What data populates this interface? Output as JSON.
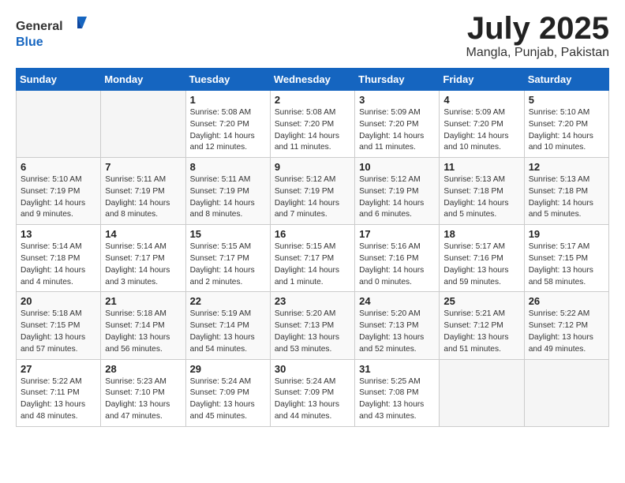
{
  "logo": {
    "general": "General",
    "blue": "Blue"
  },
  "title": {
    "month_year": "July 2025",
    "location": "Mangla, Punjab, Pakistan"
  },
  "headers": [
    "Sunday",
    "Monday",
    "Tuesday",
    "Wednesday",
    "Thursday",
    "Friday",
    "Saturday"
  ],
  "weeks": [
    [
      {
        "day": "",
        "sunrise": "",
        "sunset": "",
        "daylight": "",
        "empty": true
      },
      {
        "day": "",
        "sunrise": "",
        "sunset": "",
        "daylight": "",
        "empty": true
      },
      {
        "day": "1",
        "sunrise": "Sunrise: 5:08 AM",
        "sunset": "Sunset: 7:20 PM",
        "daylight": "Daylight: 14 hours and 12 minutes.",
        "empty": false
      },
      {
        "day": "2",
        "sunrise": "Sunrise: 5:08 AM",
        "sunset": "Sunset: 7:20 PM",
        "daylight": "Daylight: 14 hours and 11 minutes.",
        "empty": false
      },
      {
        "day": "3",
        "sunrise": "Sunrise: 5:09 AM",
        "sunset": "Sunset: 7:20 PM",
        "daylight": "Daylight: 14 hours and 11 minutes.",
        "empty": false
      },
      {
        "day": "4",
        "sunrise": "Sunrise: 5:09 AM",
        "sunset": "Sunset: 7:20 PM",
        "daylight": "Daylight: 14 hours and 10 minutes.",
        "empty": false
      },
      {
        "day": "5",
        "sunrise": "Sunrise: 5:10 AM",
        "sunset": "Sunset: 7:20 PM",
        "daylight": "Daylight: 14 hours and 10 minutes.",
        "empty": false
      }
    ],
    [
      {
        "day": "6",
        "sunrise": "Sunrise: 5:10 AM",
        "sunset": "Sunset: 7:19 PM",
        "daylight": "Daylight: 14 hours and 9 minutes.",
        "empty": false
      },
      {
        "day": "7",
        "sunrise": "Sunrise: 5:11 AM",
        "sunset": "Sunset: 7:19 PM",
        "daylight": "Daylight: 14 hours and 8 minutes.",
        "empty": false
      },
      {
        "day": "8",
        "sunrise": "Sunrise: 5:11 AM",
        "sunset": "Sunset: 7:19 PM",
        "daylight": "Daylight: 14 hours and 8 minutes.",
        "empty": false
      },
      {
        "day": "9",
        "sunrise": "Sunrise: 5:12 AM",
        "sunset": "Sunset: 7:19 PM",
        "daylight": "Daylight: 14 hours and 7 minutes.",
        "empty": false
      },
      {
        "day": "10",
        "sunrise": "Sunrise: 5:12 AM",
        "sunset": "Sunset: 7:19 PM",
        "daylight": "Daylight: 14 hours and 6 minutes.",
        "empty": false
      },
      {
        "day": "11",
        "sunrise": "Sunrise: 5:13 AM",
        "sunset": "Sunset: 7:18 PM",
        "daylight": "Daylight: 14 hours and 5 minutes.",
        "empty": false
      },
      {
        "day": "12",
        "sunrise": "Sunrise: 5:13 AM",
        "sunset": "Sunset: 7:18 PM",
        "daylight": "Daylight: 14 hours and 5 minutes.",
        "empty": false
      }
    ],
    [
      {
        "day": "13",
        "sunrise": "Sunrise: 5:14 AM",
        "sunset": "Sunset: 7:18 PM",
        "daylight": "Daylight: 14 hours and 4 minutes.",
        "empty": false
      },
      {
        "day": "14",
        "sunrise": "Sunrise: 5:14 AM",
        "sunset": "Sunset: 7:17 PM",
        "daylight": "Daylight: 14 hours and 3 minutes.",
        "empty": false
      },
      {
        "day": "15",
        "sunrise": "Sunrise: 5:15 AM",
        "sunset": "Sunset: 7:17 PM",
        "daylight": "Daylight: 14 hours and 2 minutes.",
        "empty": false
      },
      {
        "day": "16",
        "sunrise": "Sunrise: 5:15 AM",
        "sunset": "Sunset: 7:17 PM",
        "daylight": "Daylight: 14 hours and 1 minute.",
        "empty": false
      },
      {
        "day": "17",
        "sunrise": "Sunrise: 5:16 AM",
        "sunset": "Sunset: 7:16 PM",
        "daylight": "Daylight: 14 hours and 0 minutes.",
        "empty": false
      },
      {
        "day": "18",
        "sunrise": "Sunrise: 5:17 AM",
        "sunset": "Sunset: 7:16 PM",
        "daylight": "Daylight: 13 hours and 59 minutes.",
        "empty": false
      },
      {
        "day": "19",
        "sunrise": "Sunrise: 5:17 AM",
        "sunset": "Sunset: 7:15 PM",
        "daylight": "Daylight: 13 hours and 58 minutes.",
        "empty": false
      }
    ],
    [
      {
        "day": "20",
        "sunrise": "Sunrise: 5:18 AM",
        "sunset": "Sunset: 7:15 PM",
        "daylight": "Daylight: 13 hours and 57 minutes.",
        "empty": false
      },
      {
        "day": "21",
        "sunrise": "Sunrise: 5:18 AM",
        "sunset": "Sunset: 7:14 PM",
        "daylight": "Daylight: 13 hours and 56 minutes.",
        "empty": false
      },
      {
        "day": "22",
        "sunrise": "Sunrise: 5:19 AM",
        "sunset": "Sunset: 7:14 PM",
        "daylight": "Daylight: 13 hours and 54 minutes.",
        "empty": false
      },
      {
        "day": "23",
        "sunrise": "Sunrise: 5:20 AM",
        "sunset": "Sunset: 7:13 PM",
        "daylight": "Daylight: 13 hours and 53 minutes.",
        "empty": false
      },
      {
        "day": "24",
        "sunrise": "Sunrise: 5:20 AM",
        "sunset": "Sunset: 7:13 PM",
        "daylight": "Daylight: 13 hours and 52 minutes.",
        "empty": false
      },
      {
        "day": "25",
        "sunrise": "Sunrise: 5:21 AM",
        "sunset": "Sunset: 7:12 PM",
        "daylight": "Daylight: 13 hours and 51 minutes.",
        "empty": false
      },
      {
        "day": "26",
        "sunrise": "Sunrise: 5:22 AM",
        "sunset": "Sunset: 7:12 PM",
        "daylight": "Daylight: 13 hours and 49 minutes.",
        "empty": false
      }
    ],
    [
      {
        "day": "27",
        "sunrise": "Sunrise: 5:22 AM",
        "sunset": "Sunset: 7:11 PM",
        "daylight": "Daylight: 13 hours and 48 minutes.",
        "empty": false
      },
      {
        "day": "28",
        "sunrise": "Sunrise: 5:23 AM",
        "sunset": "Sunset: 7:10 PM",
        "daylight": "Daylight: 13 hours and 47 minutes.",
        "empty": false
      },
      {
        "day": "29",
        "sunrise": "Sunrise: 5:24 AM",
        "sunset": "Sunset: 7:09 PM",
        "daylight": "Daylight: 13 hours and 45 minutes.",
        "empty": false
      },
      {
        "day": "30",
        "sunrise": "Sunrise: 5:24 AM",
        "sunset": "Sunset: 7:09 PM",
        "daylight": "Daylight: 13 hours and 44 minutes.",
        "empty": false
      },
      {
        "day": "31",
        "sunrise": "Sunrise: 5:25 AM",
        "sunset": "Sunset: 7:08 PM",
        "daylight": "Daylight: 13 hours and 43 minutes.",
        "empty": false
      },
      {
        "day": "",
        "sunrise": "",
        "sunset": "",
        "daylight": "",
        "empty": true
      },
      {
        "day": "",
        "sunrise": "",
        "sunset": "",
        "daylight": "",
        "empty": true
      }
    ]
  ]
}
